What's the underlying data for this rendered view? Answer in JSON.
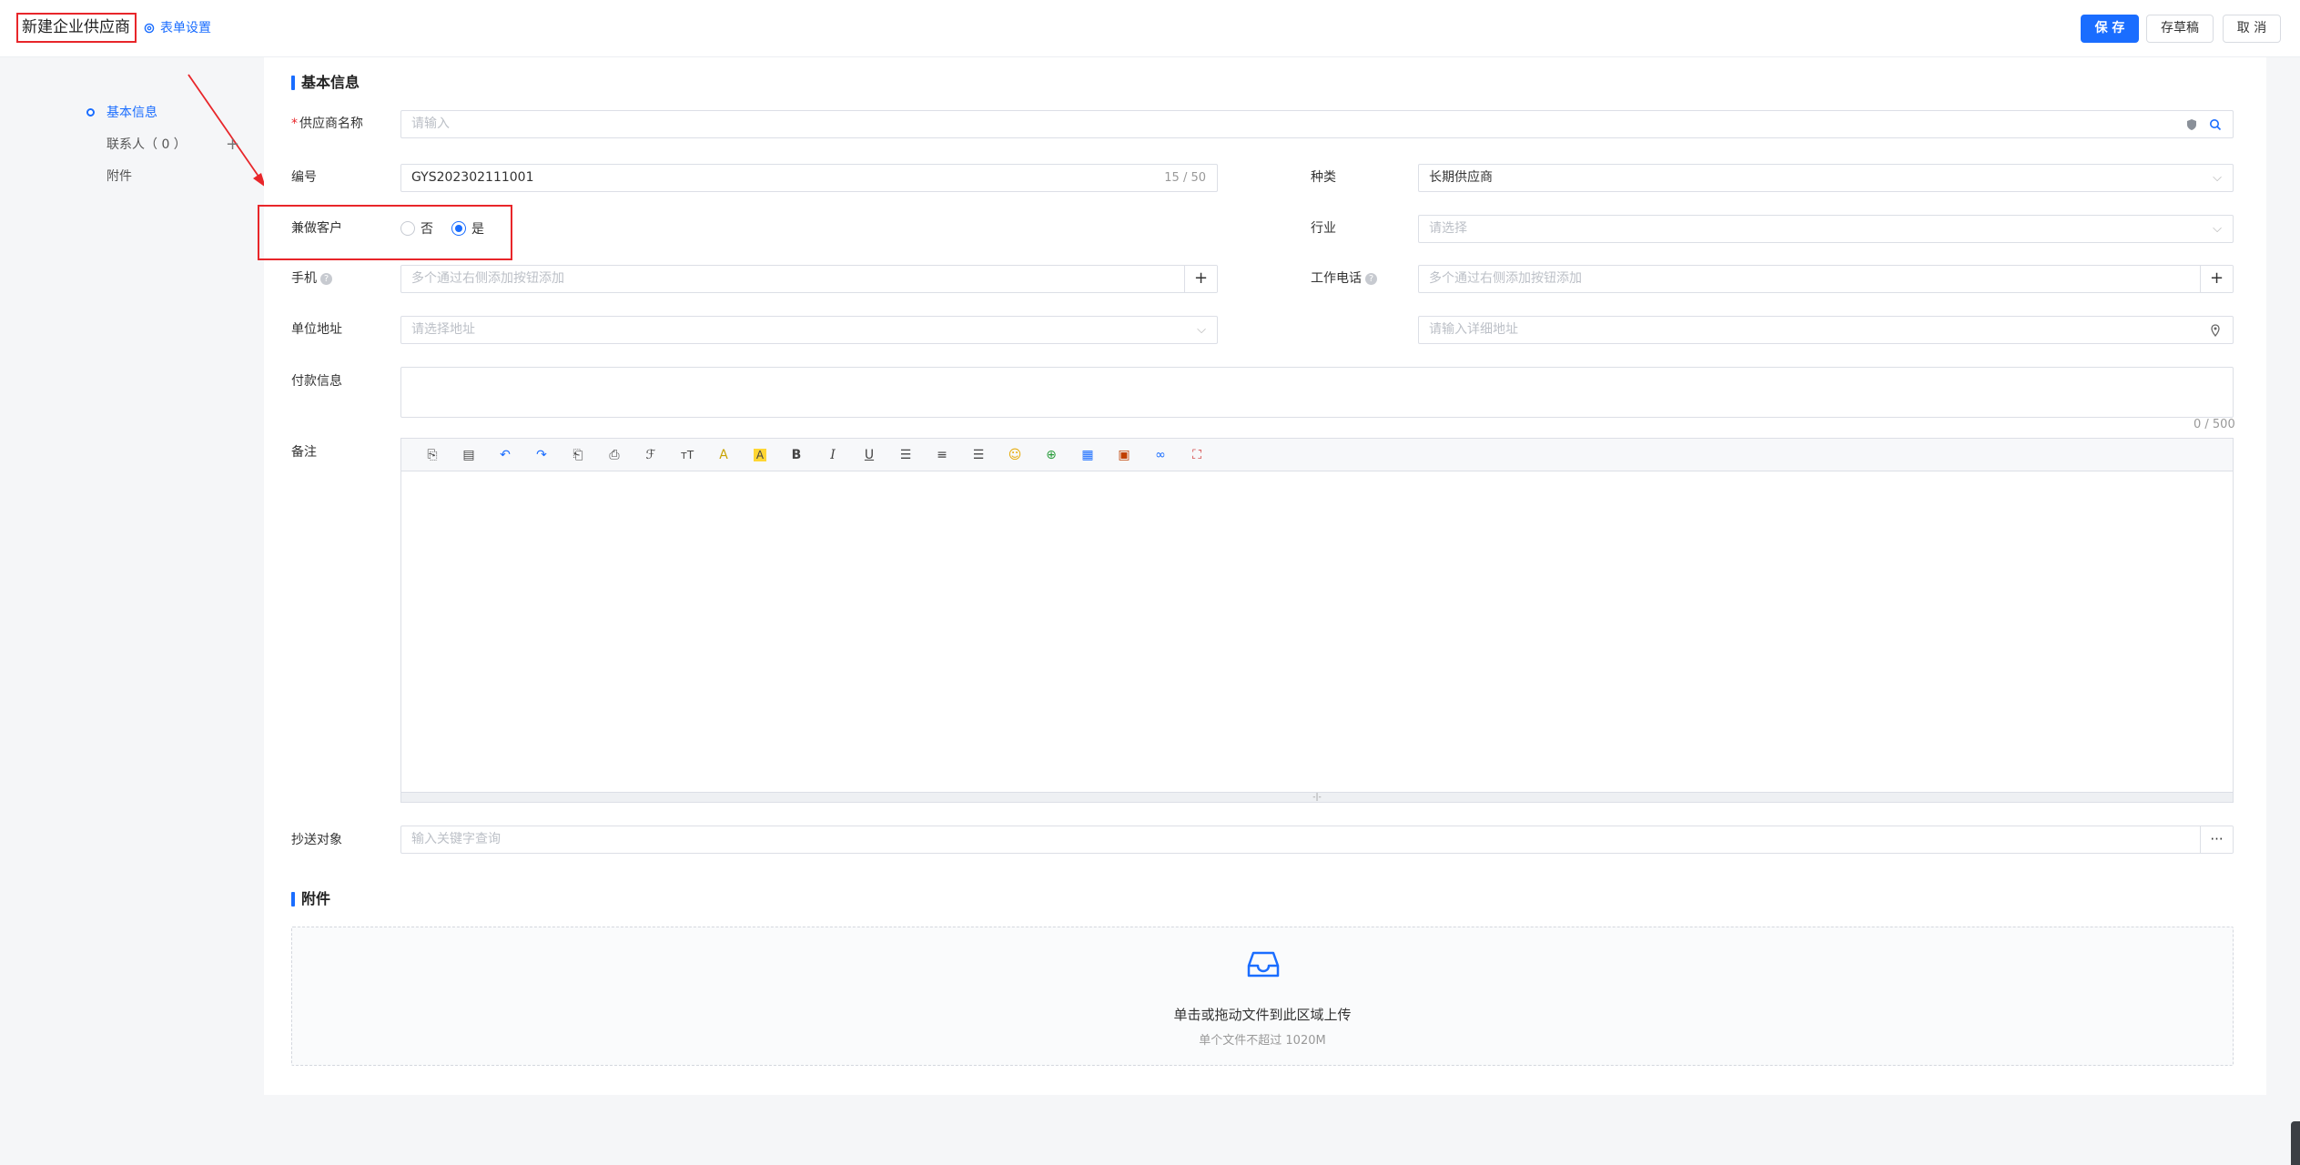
{
  "header": {
    "title": "新建企业供应商",
    "form_settings": "表单设置",
    "save": "保 存",
    "draft": "存草稿",
    "cancel": "取 消"
  },
  "nav": {
    "items": [
      {
        "label": "基本信息"
      },
      {
        "label": "联系人（ 0 ）",
        "plus": "+"
      },
      {
        "label": "附件"
      }
    ]
  },
  "basic": {
    "section_title": "基本信息",
    "supplier_name": {
      "req": "*",
      "label": "供应商名称",
      "placeholder": "请输入"
    },
    "code": {
      "label": "编号",
      "value": "GYS202302111001",
      "counter": "15 / 50"
    },
    "category": {
      "label": "种类",
      "value": "长期供应商"
    },
    "also_customer": {
      "label": "兼做客户",
      "options": [
        "否",
        "是"
      ],
      "selected": "是"
    },
    "industry": {
      "label": "行业",
      "placeholder": "请选择"
    },
    "mobile": {
      "label": "手机",
      "help": "?",
      "placeholder": "多个通过右侧添加按钮添加",
      "add": "+"
    },
    "work_phone": {
      "label": "工作电话",
      "help": "?",
      "placeholder": "多个通过右侧添加按钮添加",
      "add": "+"
    },
    "address": {
      "label": "单位地址",
      "placeholder": "请选择地址",
      "detail_placeholder": "请输入详细地址"
    },
    "payment": {
      "label": "付款信息",
      "counter": "0 / 500"
    },
    "remark": {
      "label": "备注",
      "resize": "-|-"
    },
    "cc": {
      "label": "抄送对象",
      "placeholder": "输入关键字查询",
      "more": "···"
    }
  },
  "attachment": {
    "section_title": "附件",
    "upload_text": "单击或拖动文件到此区域上传",
    "upload_hint": "单个文件不超过 1020M"
  },
  "colors": {
    "accent": "#1a6dff",
    "annotation": "#e8262a"
  }
}
